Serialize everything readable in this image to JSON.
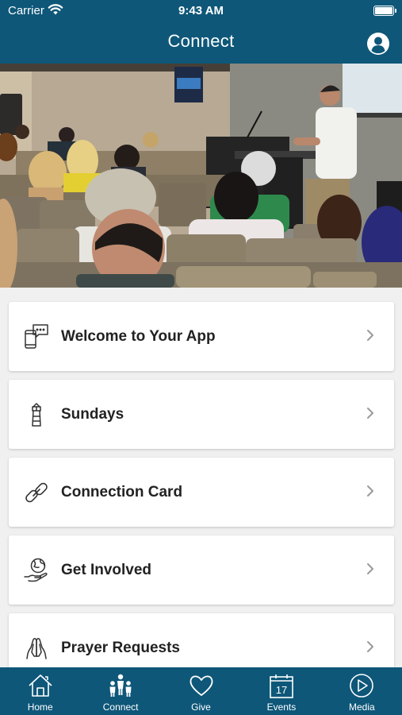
{
  "status_bar": {
    "carrier": "Carrier",
    "time": "9:43 AM"
  },
  "nav": {
    "title": "Connect",
    "profile_icon": "user-circle-icon"
  },
  "hero": {
    "image": "church-congregation-photo"
  },
  "menu": {
    "items": [
      {
        "label": "Welcome to Your App",
        "icon": "phone-chat-icon"
      },
      {
        "label": "Sundays",
        "icon": "lighthouse-icon"
      },
      {
        "label": "Connection Card",
        "icon": "link-icon"
      },
      {
        "label": "Get Involved",
        "icon": "hand-globe-icon"
      },
      {
        "label": "Prayer Requests",
        "icon": "praying-hands-icon"
      }
    ]
  },
  "tabs": [
    {
      "label": "Home",
      "icon": "home-icon"
    },
    {
      "label": "Connect",
      "icon": "people-icon",
      "active": true
    },
    {
      "label": "Give",
      "icon": "heart-icon"
    },
    {
      "label": "Events",
      "icon": "calendar-icon",
      "calendar_day": "17"
    },
    {
      "label": "Media",
      "icon": "play-icon"
    }
  ],
  "colors": {
    "brand": "#0e5779",
    "background": "#f0f0f0",
    "card": "#ffffff",
    "text": "#222222"
  }
}
